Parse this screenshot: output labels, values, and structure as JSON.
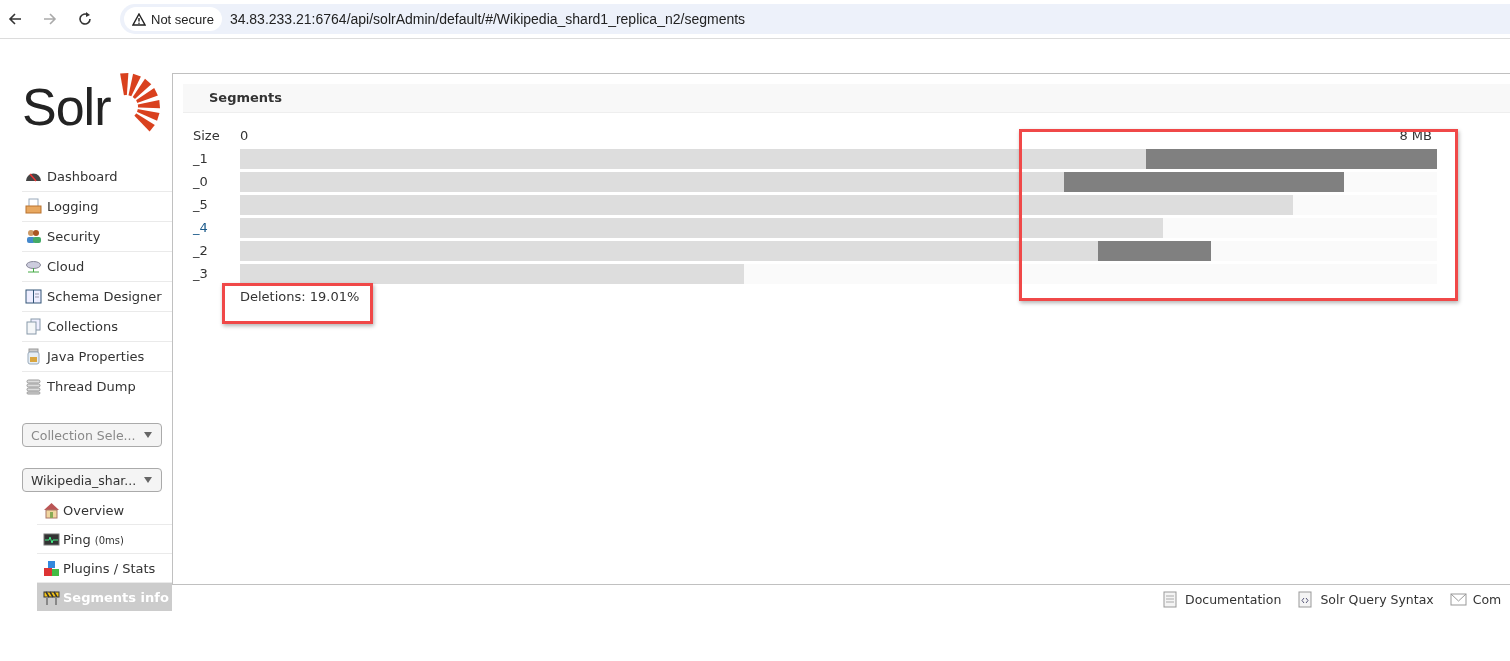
{
  "browser": {
    "security_label": "Not secure",
    "url": "34.83.233.21:6764/api/solrAdmin/default/#/Wikipedia_shard1_replica_n2/segments"
  },
  "logo": {
    "text": "Solr"
  },
  "sidebar": {
    "items": [
      {
        "label": "Dashboard",
        "kind": "dashboard"
      },
      {
        "label": "Logging",
        "kind": "logging"
      },
      {
        "label": "Security",
        "kind": "security"
      },
      {
        "label": "Cloud",
        "kind": "cloud"
      },
      {
        "label": "Schema Designer",
        "kind": "schema"
      },
      {
        "label": "Collections",
        "kind": "collections"
      },
      {
        "label": "Java Properties",
        "kind": "java"
      },
      {
        "label": "Thread Dump",
        "kind": "threads"
      }
    ],
    "collection_selector": {
      "placeholder": "Collection Sele..."
    },
    "core_selector": {
      "value": "Wikipedia_shar..."
    },
    "core_items": [
      {
        "label": "Overview",
        "kind": "overview",
        "selected": false
      },
      {
        "label": "Ping",
        "note": "(0ms)",
        "kind": "ping",
        "selected": false
      },
      {
        "label": "Plugins / Stats",
        "kind": "plugins",
        "selected": false
      },
      {
        "label": "Segments info",
        "kind": "segments",
        "selected": true
      }
    ]
  },
  "panel": {
    "title": "Segments",
    "size_label": "Size",
    "scale_min": "0",
    "scale_max": "8 MB",
    "segments": [
      {
        "name": "_1",
        "link": false,
        "level": 1.0,
        "live_docs": {
          "level": 0.757
        }
      },
      {
        "name": "_0",
        "link": false,
        "level": 0.922,
        "live_docs": {
          "level": 0.688
        }
      },
      {
        "name": "_5",
        "link": false,
        "level": 0.88
      },
      {
        "name": "_4",
        "link": true,
        "level": 0.771
      },
      {
        "name": "_2",
        "link": false,
        "level": 0.811,
        "live_docs": {
          "level": 0.717
        }
      },
      {
        "name": "_3",
        "link": false,
        "level": 0.421
      }
    ],
    "bar_ends_highlighted": true,
    "deletions": {
      "text": "Deletions: 19.01%",
      "highlighted": true
    }
  },
  "footer": {
    "links": [
      {
        "label": "Documentation",
        "kind": "doc"
      },
      {
        "label": "Solr Query Syntax",
        "kind": "syntax"
      },
      {
        "label": "Com",
        "kind": "mail"
      }
    ]
  }
}
